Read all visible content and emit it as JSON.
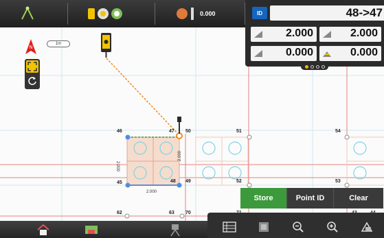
{
  "statusbar": {
    "gps_value": "0.000"
  },
  "info_panel": {
    "id_label": "ID",
    "id_value": "48->47",
    "row1": {
      "left": "2.000",
      "right": "2.000"
    },
    "row2": {
      "left": "0.000",
      "right": "0.000"
    }
  },
  "map": {
    "scale_label": "1m",
    "dim_horizontal": "2.000",
    "dim_vertical_left": "2.000",
    "dim_vertical_right": "2.000",
    "points": [
      "46",
      "47",
      "50",
      "51",
      "54",
      "45",
      "48",
      "49",
      "52",
      "53",
      "62",
      "63",
      "70",
      "71",
      "43",
      "44"
    ]
  },
  "actions": {
    "store": "Store",
    "point_id": "Point ID",
    "clear": "Clear"
  },
  "colors": {
    "accent_green": "#3c9a3c",
    "id_blue": "#1565c0",
    "highlight_yellow": "#f2c300",
    "grid_red": "#e05050",
    "dark_bar": "#2b2b2b"
  }
}
